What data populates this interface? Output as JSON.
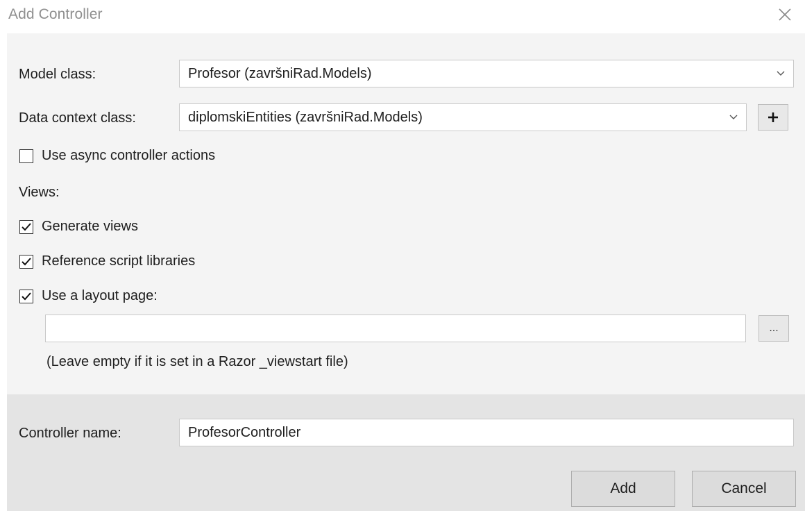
{
  "window": {
    "title": "Add Controller",
    "close_icon": "close-icon"
  },
  "form": {
    "model_class": {
      "label": "Model class:",
      "value": "Profesor (završniRad.Models)"
    },
    "data_context_class": {
      "label": "Data context class:",
      "value": "diplomskiEntities (završniRad.Models)",
      "add_label": "+"
    },
    "use_async": {
      "label": "Use async controller actions",
      "checked": false
    },
    "views": {
      "heading": "Views:",
      "generate_views": {
        "label": "Generate views",
        "checked": true
      },
      "reference_scripts": {
        "label": "Reference script libraries",
        "checked": true
      },
      "use_layout_page": {
        "label": "Use a layout page:",
        "checked": true
      },
      "layout_path": {
        "value": "",
        "placeholder": ""
      },
      "browse_label": "...",
      "hint": "(Leave empty if it is set in a Razor _viewstart file)"
    }
  },
  "footer": {
    "controller_name_label": "Controller name:",
    "controller_name_value": "ProfesorController",
    "add_label": "Add",
    "cancel_label": "Cancel"
  },
  "colors": {
    "title_text": "#8f8f8f",
    "content_bg": "#f4f4f4",
    "footer_bg": "#e4e4e4",
    "button_bg": "#dcdcdc"
  }
}
